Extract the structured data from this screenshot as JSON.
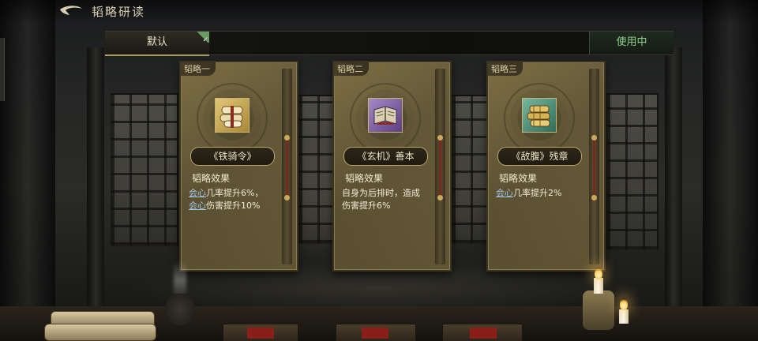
{
  "header": {
    "back_icon": "back-arrow-icon",
    "title": "韬略研读"
  },
  "top_bar": {
    "preset_label": "默认",
    "preset_selected": true,
    "status_label": "使用中"
  },
  "cards": [
    {
      "tag": "韬略一",
      "item_name": "《铁骑令》",
      "icon": "scroll-bundle-icon",
      "rarity_color": "#c9a24f",
      "effect_title": "韬略效果",
      "effect_parts": [
        {
          "text": "会心",
          "keyword": true
        },
        {
          "text": "几率提升6%，",
          "keyword": false
        },
        {
          "text": "会心",
          "keyword": true
        },
        {
          "text": "伤害提升10%",
          "keyword": false
        }
      ]
    },
    {
      "tag": "韬略二",
      "item_name": "《玄机》善本",
      "icon": "open-book-icon",
      "rarity_color": "#7b5aa6",
      "effect_title": "韬略效果",
      "effect_parts": [
        {
          "text": "自身为后排时，造成伤害提升6%",
          "keyword": false
        }
      ]
    },
    {
      "tag": "韬略三",
      "item_name": "《敌腹》残章",
      "icon": "bamboo-slips-icon",
      "rarity_color": "#3f8a73",
      "effect_title": "韬略效果",
      "effect_parts": [
        {
          "text": "会心",
          "keyword": true
        },
        {
          "text": "几率提升2%",
          "keyword": false
        }
      ]
    }
  ]
}
